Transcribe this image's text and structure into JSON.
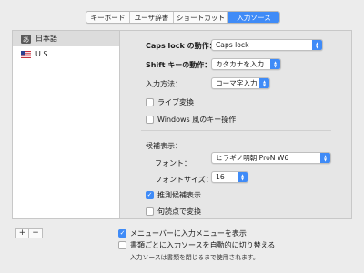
{
  "tabs": [
    {
      "label": "キーボード",
      "active": false
    },
    {
      "label": "ユーザ辞書",
      "active": false
    },
    {
      "label": "ショートカット",
      "active": false
    },
    {
      "label": "入力ソース",
      "active": true
    }
  ],
  "sources": [
    {
      "label": "日本語",
      "icon": "japanese-input-icon",
      "selected": true
    },
    {
      "label": "U.S.",
      "icon": "us-flag-icon",
      "selected": false
    }
  ],
  "settings": {
    "caps_lock_label": "Caps lock の動作：",
    "caps_lock_value": "Caps lock",
    "shift_label": "Shift キーの動作：",
    "shift_value": "カタカナを入力",
    "input_method_label": "入力方法：",
    "input_method_value": "ローマ字入力",
    "live_conversion_label": "ライブ変換",
    "live_conversion_checked": false,
    "windows_keys_label": "Windows 風のキー操作",
    "windows_keys_checked": false,
    "candidates_heading": "候補表示：",
    "font_label": "フォント：",
    "font_value": "ヒラギノ明朝 ProN W6",
    "font_size_label": "フォントサイズ：",
    "font_size_value": "16",
    "predictive_label": "推測候補表示",
    "predictive_checked": true,
    "punctuation_label": "句読点で変換",
    "punctuation_checked": false
  },
  "list_buttons": {
    "add": "+",
    "remove": "−"
  },
  "footer": {
    "menu_bar_label": "メニューバーに入力メニューを表示",
    "menu_bar_checked": true,
    "auto_switch_label": "書類ごとに入力ソースを自動的に切り替える",
    "auto_switch_checked": false,
    "note": "入力ソースは書類を閉じるまで使用されます。"
  },
  "colors": {
    "accent": "#3f8bf7"
  }
}
